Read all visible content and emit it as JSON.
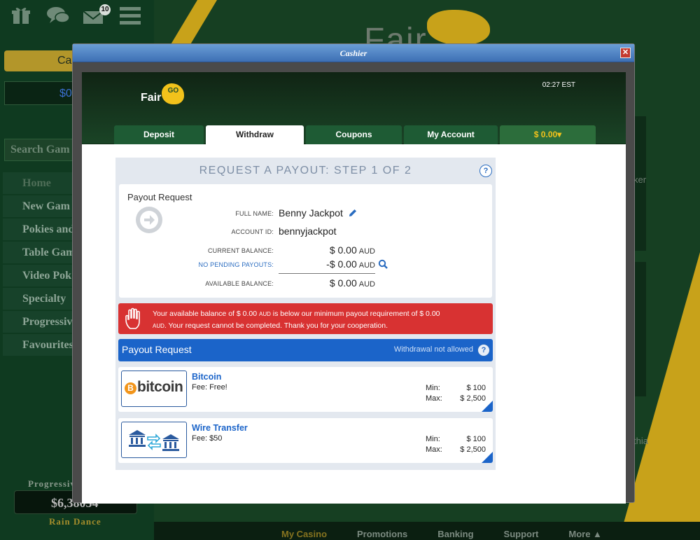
{
  "background": {
    "notification_count": "10",
    "cashier_label": "Ca",
    "balance": "$0",
    "search_placeholder": "Search Gam",
    "menu": [
      "Home",
      "New Gam",
      "Pokies and",
      "Table Gam",
      "Video Pok",
      "Specialty",
      "Progressiv",
      "Favourites"
    ],
    "progressive_label": "Progressiv",
    "progressive_amount": "$6,38054",
    "progressive_game": "Rain Dance",
    "side_text_1": "ker",
    "side_text_2": "thia",
    "footer": [
      "My Casino",
      "Promotions",
      "Banking",
      "Support",
      "More ▲"
    ]
  },
  "modal": {
    "title": "Cashier",
    "close_glyph": "✕"
  },
  "header": {
    "logo_text": "Fair",
    "logo_go": "GO",
    "time": "02:27 EST"
  },
  "tabs": [
    {
      "label": "Deposit"
    },
    {
      "label": "Withdraw"
    },
    {
      "label": "Coupons"
    },
    {
      "label": "My Account"
    },
    {
      "label": "$ 0.00▾"
    }
  ],
  "step": {
    "title": "REQUEST A PAYOUT: STEP 1 OF 2",
    "help": "?"
  },
  "request": {
    "title": "Payout Request",
    "full_name_label": "FULL NAME:",
    "full_name": "Benny Jackpot",
    "account_id_label": "ACCOUNT ID:",
    "account_id": "bennyjackpot",
    "current_balance_label": "CURRENT BALANCE:",
    "current_balance": "$ 0.00",
    "pending_label": "NO PENDING PAYOUTS:",
    "pending_amount": "-$ 0.00",
    "available_label": "AVAILABLE BALANCE:",
    "available_balance": "$ 0.00",
    "currency": "AUD"
  },
  "alert": {
    "line1_a": "Your available balance of $ 0.00 ",
    "aud": "AUD",
    "line1_b": " is below our minimum payout requirement of $ 0.00",
    "line2_b": ". Your request cannot be completed. Thank you for your cooperation."
  },
  "payout_bar": {
    "title": "Payout Request",
    "status": "Withdrawal not allowed",
    "help": "?"
  },
  "methods": [
    {
      "name": "Bitcoin",
      "fee": "Fee: Free!",
      "logo_text": "bitcoin",
      "logo_coin": "B",
      "min_label": "Min:",
      "min": "$ 100",
      "max_label": "Max:",
      "max": "$ 2,500"
    },
    {
      "name": "Wire Transfer",
      "fee": "Fee: $50",
      "min_label": "Min:",
      "min": "$ 100",
      "max_label": "Max:",
      "max": "$ 2,500"
    }
  ],
  "colors": {
    "accent_blue": "#1b64c9",
    "alert_red": "#d83232",
    "balance_gold": "#f2c21b",
    "tab_green": "#1e5b34"
  }
}
